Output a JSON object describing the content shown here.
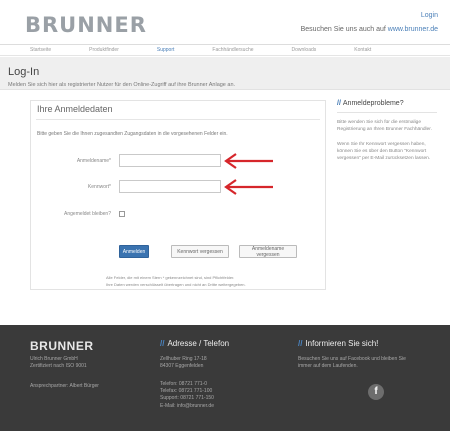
{
  "header": {
    "logo": "BRUNNER",
    "login": "Login",
    "tagline_prefix": "Besuchen Sie uns auch auf",
    "tagline_link": "www.brunner.de"
  },
  "nav": {
    "items": [
      "Startseite",
      "Produktfinder",
      "Support",
      "Fachhändlersuche",
      "Downloads",
      "Kontakt"
    ],
    "active_index": 2
  },
  "titlebar": {
    "title": "Log-In",
    "subtitle": "Melden Sie sich hier als registrierter Nutzer für den Online-Zugriff auf ihre Brunner Anlage an."
  },
  "form": {
    "title": "Ihre Anmeldedaten",
    "intro": "Bitte geben Sie die Ihnen zugesandten Zugangsdaten in die vorgesehenen Felder ein.",
    "username_label": "Anmeldename*",
    "username_value": "",
    "password_label": "Kennwort*",
    "password_value": "",
    "remember_label": "Angemeldet bleiben?",
    "remember_checked": false,
    "login_button": "Anmelden",
    "forgot_password_button": "Kennwort vergessen",
    "forgot_username_button": "Anmeldename vergessen",
    "hint_1": "Alle Felder, die mit einem Stern * gekennzeichnet sind, sind Pflichtfelder.",
    "hint_2": "Ihre Daten werden verschlüsselt übertragen und nicht an Dritte weitergegeben."
  },
  "arrow_color": "#d6262b",
  "sidebar": {
    "title": "Anmeldeprobleme?",
    "p1": "Bitte wenden Sie sich für die erstmalige Registrierung an Ihren Brunner Fachhändler.",
    "p2": "Wenn Sie Ihr Kennwort vergessen haben, können Sie es über den Button \"Kennwort vergessen\" per E-Mail zurücksetzen lassen."
  },
  "footer": {
    "brand": "BRUNNER",
    "company_1": "Ulrich Brunner GmbH",
    "company_2": "Zertifiziert nach ISO 9001",
    "company_3": "Ansprechpartner: Albert Bürger",
    "address_title": "Adresse / Telefon",
    "address_1": "Zellhuber Ring 17-18",
    "address_2": "84307 Eggenfelden",
    "phone_1": "Telefon: 08721 771-0",
    "phone_2": "Telefax: 08721 771-100",
    "phone_3": "Support: 08721 771-150",
    "email": "E-Mail: info@brunner.de",
    "info_title": "Informieren Sie sich!",
    "info_1": "Besuchen Sie uns auf Facebook und bleiben Sie",
    "info_2": "immer auf dem Laufenden.",
    "facebook_glyph": "f"
  }
}
